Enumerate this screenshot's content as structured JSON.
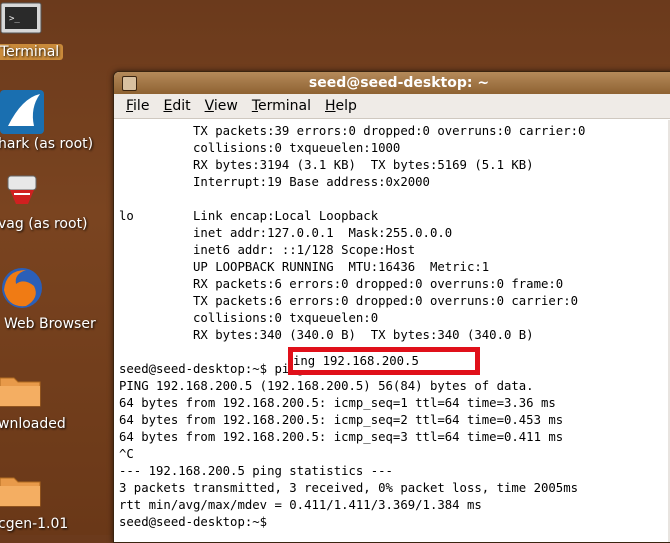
{
  "desktop": {
    "icons": [
      {
        "label": "Terminal",
        "icon": "terminal-icon"
      },
      {
        "label": "hark (as root)",
        "icon": "shark-fin-icon"
      },
      {
        "label": "vag (as root)",
        "icon": "network-tool-icon"
      },
      {
        "label": "Web Browser",
        "icon": "firefox-icon"
      },
      {
        "label": "wnloaded",
        "icon": "folder-icon"
      },
      {
        "label": "cgen-1.01",
        "icon": "folder-icon"
      }
    ]
  },
  "window": {
    "title": "seed@seed-desktop: ~",
    "menu": [
      "File",
      "Edit",
      "View",
      "Terminal",
      "Help"
    ]
  },
  "terminal": {
    "lines": [
      "          TX packets:39 errors:0 dropped:0 overruns:0 carrier:0",
      "          collisions:0 txqueuelen:1000",
      "          RX bytes:3194 (3.1 KB)  TX bytes:5169 (5.1 KB)",
      "          Interrupt:19 Base address:0x2000",
      "",
      "lo        Link encap:Local Loopback",
      "          inet addr:127.0.0.1  Mask:255.0.0.0",
      "          inet6 addr: ::1/128 Scope:Host",
      "          UP LOOPBACK RUNNING  MTU:16436  Metric:1",
      "          RX packets:6 errors:0 dropped:0 overruns:0 frame:0",
      "          TX packets:6 errors:0 dropped:0 overruns:0 carrier:0",
      "          collisions:0 txqueuelen:0",
      "          RX bytes:340 (340.0 B)  TX bytes:340 (340.0 B)",
      "",
      "seed@seed-desktop:~$ ping 192.168.200.5",
      "PING 192.168.200.5 (192.168.200.5) 56(84) bytes of data.",
      "64 bytes from 192.168.200.5: icmp_seq=1 ttl=64 time=3.36 ms",
      "64 bytes from 192.168.200.5: icmp_seq=2 ttl=64 time=0.453 ms",
      "64 bytes from 192.168.200.5: icmp_seq=3 ttl=64 time=0.411 ms",
      "^C",
      "--- 192.168.200.5 ping statistics ---",
      "3 packets transmitted, 3 received, 0% packet loss, time 2005ms",
      "rtt min/avg/max/mdev = 0.411/1.411/3.369/1.384 ms",
      "seed@seed-desktop:~$"
    ],
    "highlighted_command": "ing 192.168.200.5",
    "highlight_color": "#e0101a"
  }
}
